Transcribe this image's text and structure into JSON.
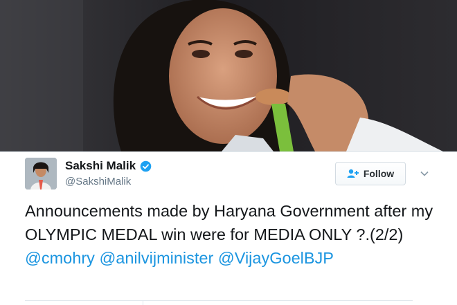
{
  "profile": {
    "display_name": "Sakshi Malik",
    "handle": "@SakshiMalik",
    "verified": true
  },
  "follow_button": {
    "label": "Follow"
  },
  "tweet": {
    "text": "Announcements made by Haryana Government after my OLYMPIC MEDAL win were for MEDIA ONLY ?.(2/2)",
    "mentions": [
      "@cmohry",
      "@anilvijminister",
      "@VijayGoelBJP"
    ]
  },
  "colors": {
    "link": "#1b95e0",
    "verified_badge": "#1da1f2",
    "text": "#14171a",
    "secondary_text": "#657786"
  },
  "icons": [
    "verified-badge-icon",
    "follow-person-plus-icon",
    "chevron-down-icon"
  ]
}
